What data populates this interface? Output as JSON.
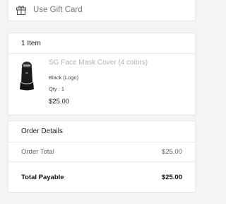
{
  "gift_card": {
    "icon": "gift-icon",
    "label": "Use Gift Card"
  },
  "items": {
    "header": "1 Item",
    "products": [
      {
        "image": "face-mask-image",
        "name": "SG Face Mask Cover (4 colors)",
        "variant": "Black (Logo)",
        "qty": "Qty : 1",
        "price": "$25.00"
      }
    ]
  },
  "order_details": {
    "header": "Order Details",
    "order_total_label": "Order Total",
    "order_total_value": "$25.00",
    "total_payable_label": "Total Payable",
    "total_payable_value": "$25.00"
  },
  "colors": {
    "background": "#f4f4f4",
    "card": "#ffffff",
    "product_name": "#b3b3b3"
  }
}
